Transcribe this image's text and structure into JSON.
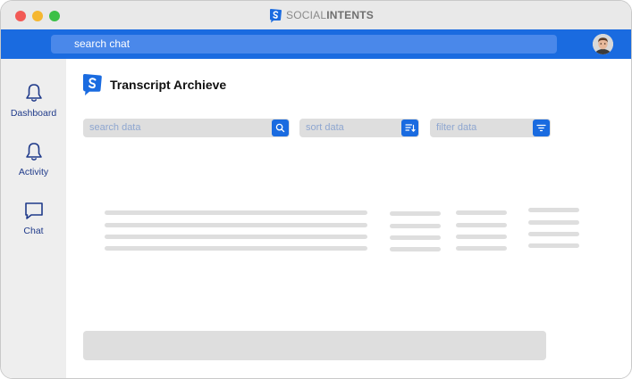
{
  "window": {
    "brand": {
      "name_light": "SOCIAL",
      "name_bold": "INTENTS"
    }
  },
  "topbar": {
    "search_label": "search chat"
  },
  "sidebar": {
    "items": [
      {
        "label": "Dashboard",
        "icon": "bell-icon"
      },
      {
        "label": "Activity",
        "icon": "bell-icon"
      },
      {
        "label": "Chat",
        "icon": "chat-bubble-icon"
      }
    ]
  },
  "main": {
    "title": "Transcript Archieve",
    "filters": {
      "search": {
        "label": "search data",
        "icon": "search-icon"
      },
      "sort": {
        "label": "sort data",
        "icon": "sort-icon"
      },
      "filter": {
        "label": "filter data",
        "icon": "filter-icon"
      }
    }
  },
  "colors": {
    "accent": "#1a6be0",
    "sidebar_bg": "#eeeeee",
    "nav_text": "#1f3a8a",
    "placeholder": "#dedede"
  }
}
